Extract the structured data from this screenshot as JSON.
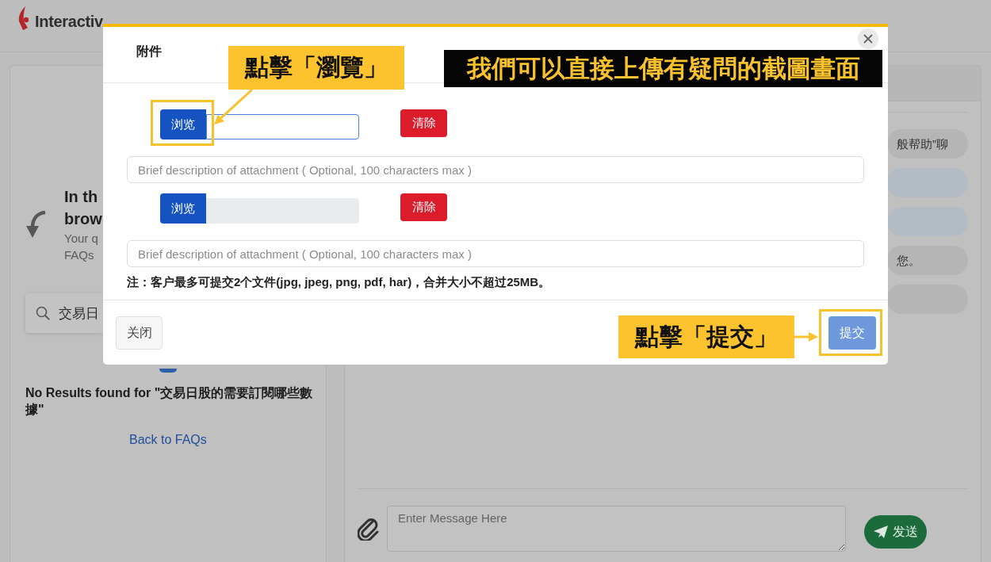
{
  "header": {
    "logo_text": "Interactiv"
  },
  "faq_panel": {
    "heading_lines": [
      "In th",
      "brow"
    ],
    "subtext_lines": [
      "Your q",
      "FAQs"
    ],
    "search": {
      "value": "交易日"
    },
    "no_results": "No Results found for \"交易日股的需要訂閱哪些數據\"",
    "back_link": "Back to FAQs"
  },
  "chat_panel": {
    "messages": [
      {
        "kind": "agent",
        "text": "般帮助”聊"
      },
      {
        "kind": "user"
      },
      {
        "kind": "user"
      },
      {
        "kind": "agent",
        "text": "您。"
      },
      {
        "kind": "agent"
      }
    ],
    "composer": {
      "placeholder": "Enter Message Here",
      "send_button": "发送"
    }
  },
  "dialog": {
    "title": "附件",
    "attachments": [
      {
        "browse_button": "浏览",
        "file_field": {
          "focused": true,
          "disabled": false
        },
        "clear_button": "清除",
        "highlighted": true,
        "description": {
          "placeholder": "Brief description of attachment ( Optional, 100 characters max )"
        }
      },
      {
        "browse_button": "浏览",
        "file_field": {
          "focused": false,
          "disabled": true
        },
        "clear_button": "清除",
        "highlighted": false,
        "description": {
          "placeholder": "Brief description of attachment ( Optional, 100 characters max )"
        }
      }
    ],
    "note": "注：客户最多可提交2个文件(jpg, jpeg, png, pdf, har)，合并大小不超过25MB。",
    "close_button": "关闭",
    "submit_button": {
      "label": "提交",
      "disabled": true,
      "highlighted": true
    }
  },
  "annotations": [
    {
      "kind": "callout",
      "text": "點擊「瀏覽」"
    },
    {
      "kind": "banner",
      "text": "我們可以直接上傳有疑問的截圖畫面"
    },
    {
      "kind": "callout",
      "text": "點擊「提交」"
    }
  ]
}
